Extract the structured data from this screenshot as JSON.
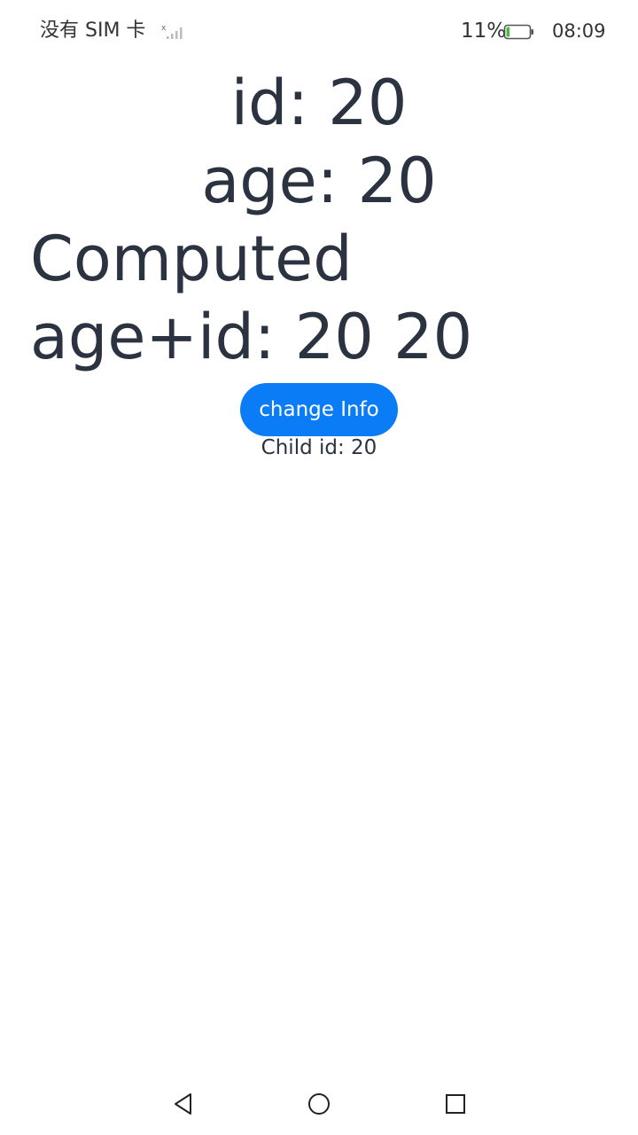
{
  "status_bar": {
    "carrier": "没有 SIM 卡",
    "battery_percent": "11%",
    "battery_level": 0.11,
    "time": "08:09",
    "icons": [
      "signal-icon",
      "battery-icon"
    ]
  },
  "main": {
    "id_line": "id: 20",
    "age_line": "age: 20",
    "computed_line": "Computed age+id: 20 20",
    "button_label": "change Info",
    "child_id": "Child id: 20"
  },
  "nav_bar": {
    "icons": [
      "back-icon",
      "home-icon",
      "recents-icon"
    ]
  },
  "colors": {
    "accent": "#0a7cf5",
    "text": "#2b3340",
    "battery_fill": "#3fbf3f"
  }
}
